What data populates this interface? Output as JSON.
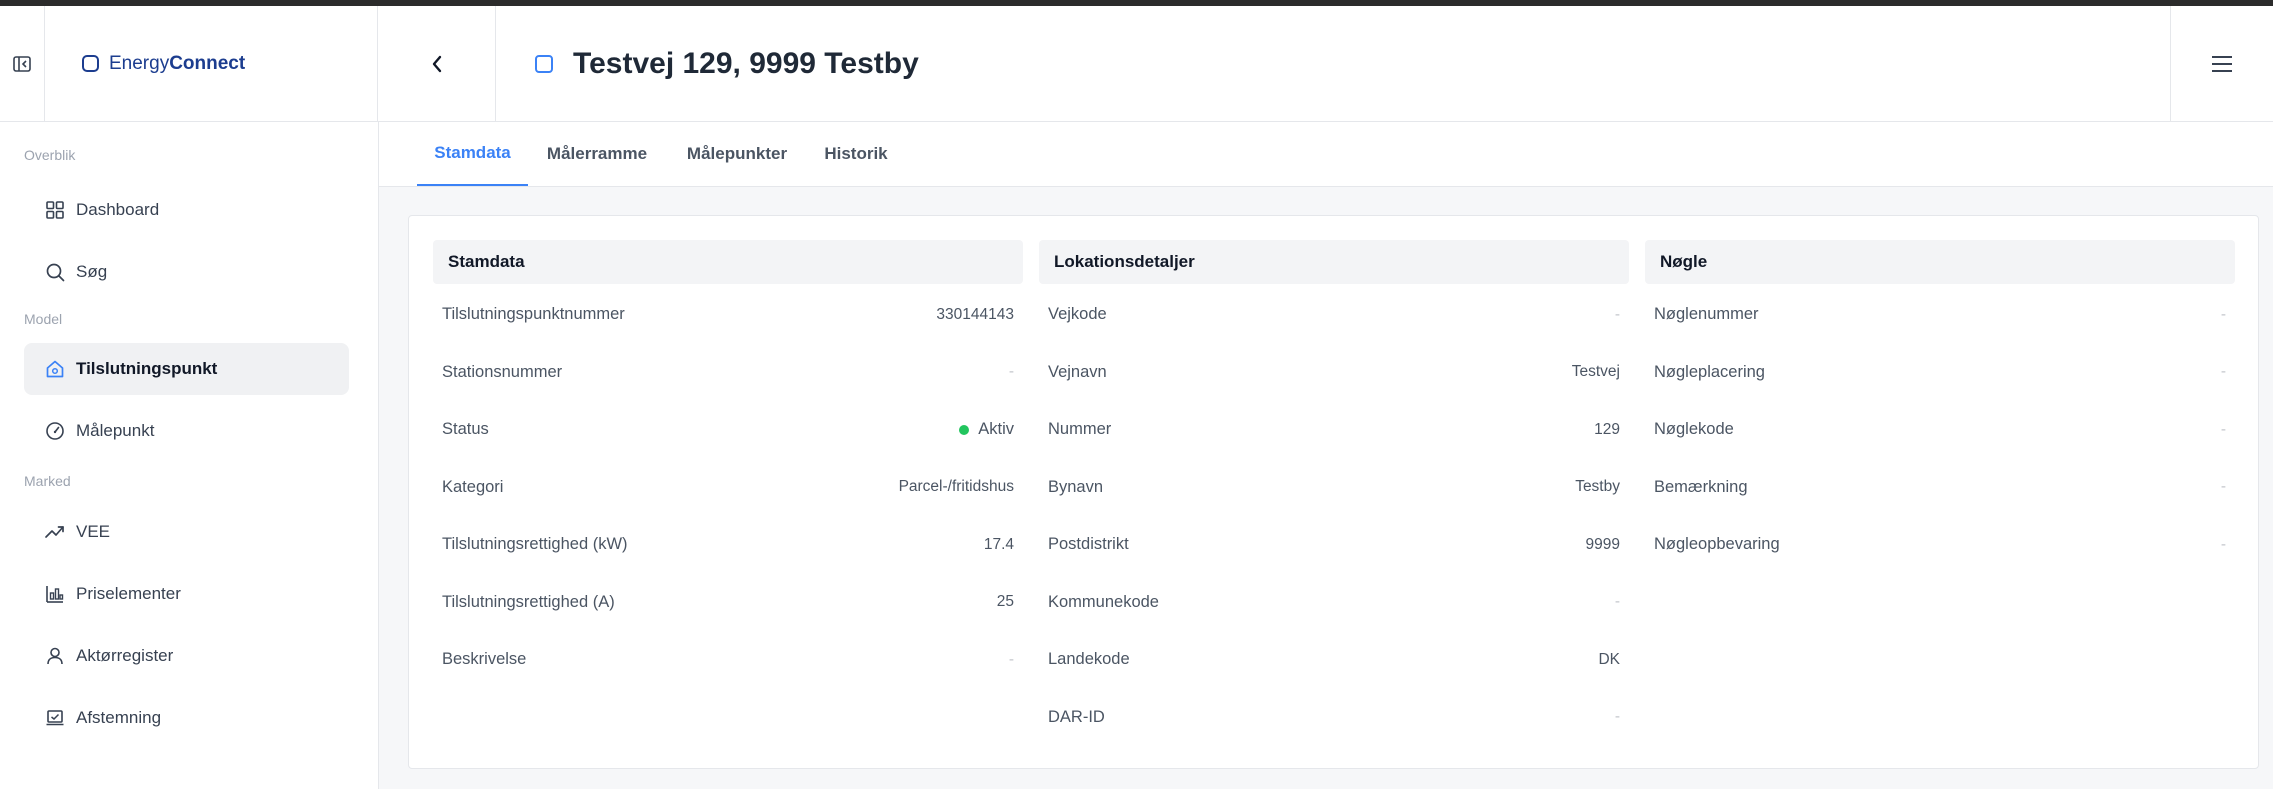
{
  "app": {
    "logo_light": "Energy",
    "logo_bold": "Connect",
    "page_title": "Testvej 129, 9999 Testby"
  },
  "colors": {
    "accent": "#3b82f6",
    "brand": "#1c3d8f",
    "status_active": "#22c55e"
  },
  "sidebar": {
    "sections": {
      "overblik": "Overblik",
      "model": "Model",
      "marked": "Marked"
    },
    "items": [
      {
        "label": "Dashboard",
        "icon": "grid-icon"
      },
      {
        "label": "Søg",
        "icon": "search-icon"
      },
      {
        "label": "Tilslutningspunkt",
        "icon": "house-icon",
        "active": true
      },
      {
        "label": "Målepunkt",
        "icon": "gauge-icon"
      },
      {
        "label": "VEE",
        "icon": "trend-icon"
      },
      {
        "label": "Priselementer",
        "icon": "chart-icon"
      },
      {
        "label": "Aktørregister",
        "icon": "user-icon"
      },
      {
        "label": "Afstemning",
        "icon": "check-screen-icon"
      }
    ]
  },
  "tabs": [
    {
      "label": "Stamdata",
      "active": true
    },
    {
      "label": "Målerramme"
    },
    {
      "label": "Målepunkter"
    },
    {
      "label": "Historik"
    }
  ],
  "panels": {
    "stamdata": {
      "title": "Stamdata",
      "rows": [
        {
          "label": "Tilslutningspunktnummer",
          "value": "330144143"
        },
        {
          "label": "Stationsnummer",
          "value": "-"
        },
        {
          "label": "Status",
          "value": "Aktiv"
        },
        {
          "label": "Kategori",
          "value": "Parcel-/fritidshus"
        },
        {
          "label": "Tilslutningsrettighed (kW)",
          "value": "17.4"
        },
        {
          "label": "Tilslutningsrettighed (A)",
          "value": "25"
        },
        {
          "label": "Beskrivelse",
          "value": "-"
        }
      ]
    },
    "lokation": {
      "title": "Lokationsdetaljer",
      "rows": [
        {
          "label": "Vejkode",
          "value": "-"
        },
        {
          "label": "Vejnavn",
          "value": "Testvej"
        },
        {
          "label": "Nummer",
          "value": "129"
        },
        {
          "label": "Bynavn",
          "value": "Testby"
        },
        {
          "label": "Postdistrikt",
          "value": "9999"
        },
        {
          "label": "Kommunekode",
          "value": "-"
        },
        {
          "label": "Landekode",
          "value": "DK"
        },
        {
          "label": "DAR-ID",
          "value": "-"
        }
      ]
    },
    "noegle": {
      "title": "Nøgle",
      "rows": [
        {
          "label": "Nøglenummer",
          "value": "-"
        },
        {
          "label": "Nøgleplacering",
          "value": "-"
        },
        {
          "label": "Nøglekode",
          "value": "-"
        },
        {
          "label": "Bemærkning",
          "value": "-"
        },
        {
          "label": "Nøgleopbevaring",
          "value": "-"
        }
      ]
    }
  }
}
